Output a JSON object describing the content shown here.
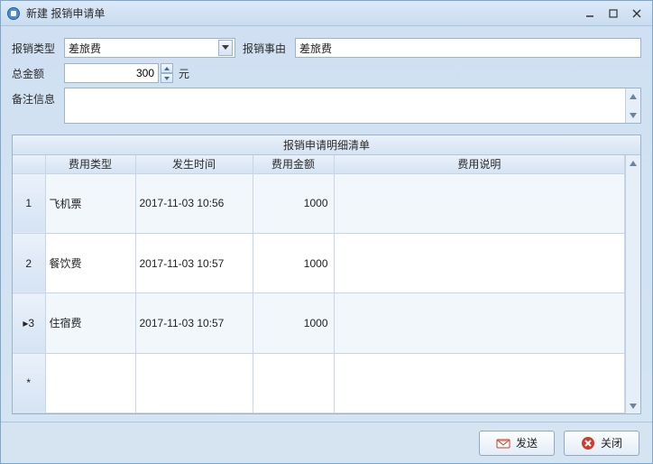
{
  "window": {
    "title": "新建 报销申请单"
  },
  "form": {
    "type_label": "报销类型",
    "type_value": "差旅费",
    "reason_label": "报销事由",
    "reason_value": "差旅费",
    "total_label": "总金额",
    "total_value": "300",
    "total_unit": "元",
    "remark_label": "备注信息",
    "remark_value": ""
  },
  "grid": {
    "title": "报销申请明细清单",
    "headers": {
      "indicator": "",
      "type": "费用类型",
      "time": "发生时间",
      "amount": "费用金额",
      "desc": "费用说明"
    },
    "rows": [
      {
        "num": "1",
        "marker": "",
        "type": "飞机票",
        "time": "2017-11-03 10:56",
        "amount": "1000",
        "desc": ""
      },
      {
        "num": "2",
        "marker": "",
        "type": "餐饮费",
        "time": "2017-11-03 10:57",
        "amount": "1000",
        "desc": ""
      },
      {
        "num": "3",
        "marker": "▸",
        "type": "住宿费",
        "time": "2017-11-03 10:57",
        "amount": "1000",
        "desc": ""
      }
    ],
    "new_row_marker": "*"
  },
  "footer": {
    "send_label": "发送",
    "close_label": "关闭"
  }
}
